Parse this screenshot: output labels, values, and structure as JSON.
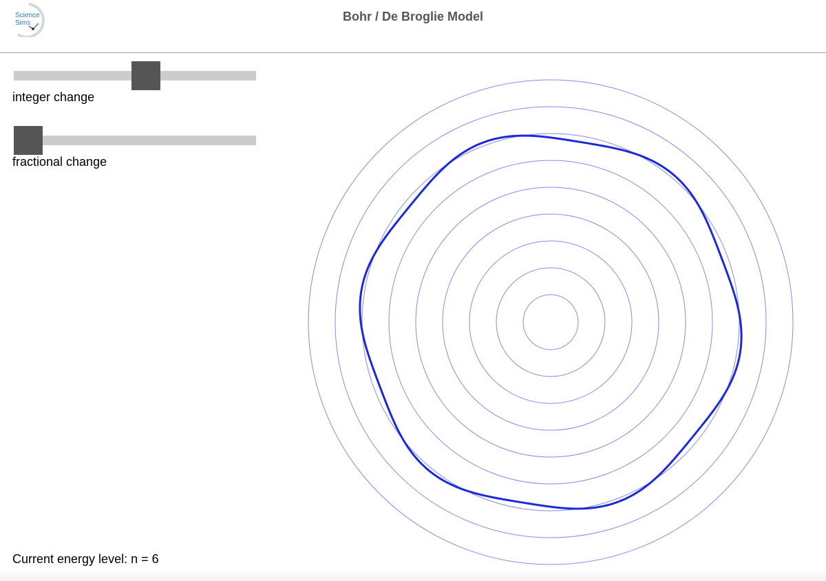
{
  "header": {
    "logo_text_line1": "Science",
    "logo_text_line2": "Sims",
    "title": "Bohr / De Broglie Model"
  },
  "controls": {
    "integer_slider": {
      "label": "integer change",
      "value": 6,
      "min": 1,
      "max": 10,
      "fraction": 0.55
    },
    "fractional_slider": {
      "label": "fractional change",
      "value": 0,
      "fraction": 0.0
    }
  },
  "status": {
    "text": "Current energy level: n = 6",
    "energy_level": 6
  },
  "diagram": {
    "orbit_count": 9,
    "current_orbit": 6,
    "orbit_color": "#8888ee",
    "wave_color": "#1a2ad8",
    "wave_cycles": 6,
    "wave_amplitude_fraction": 0.025
  },
  "colors": {
    "track": "#cccccc",
    "thumb": "#555555",
    "title": "#555555",
    "logo": "#2a7bb8"
  }
}
